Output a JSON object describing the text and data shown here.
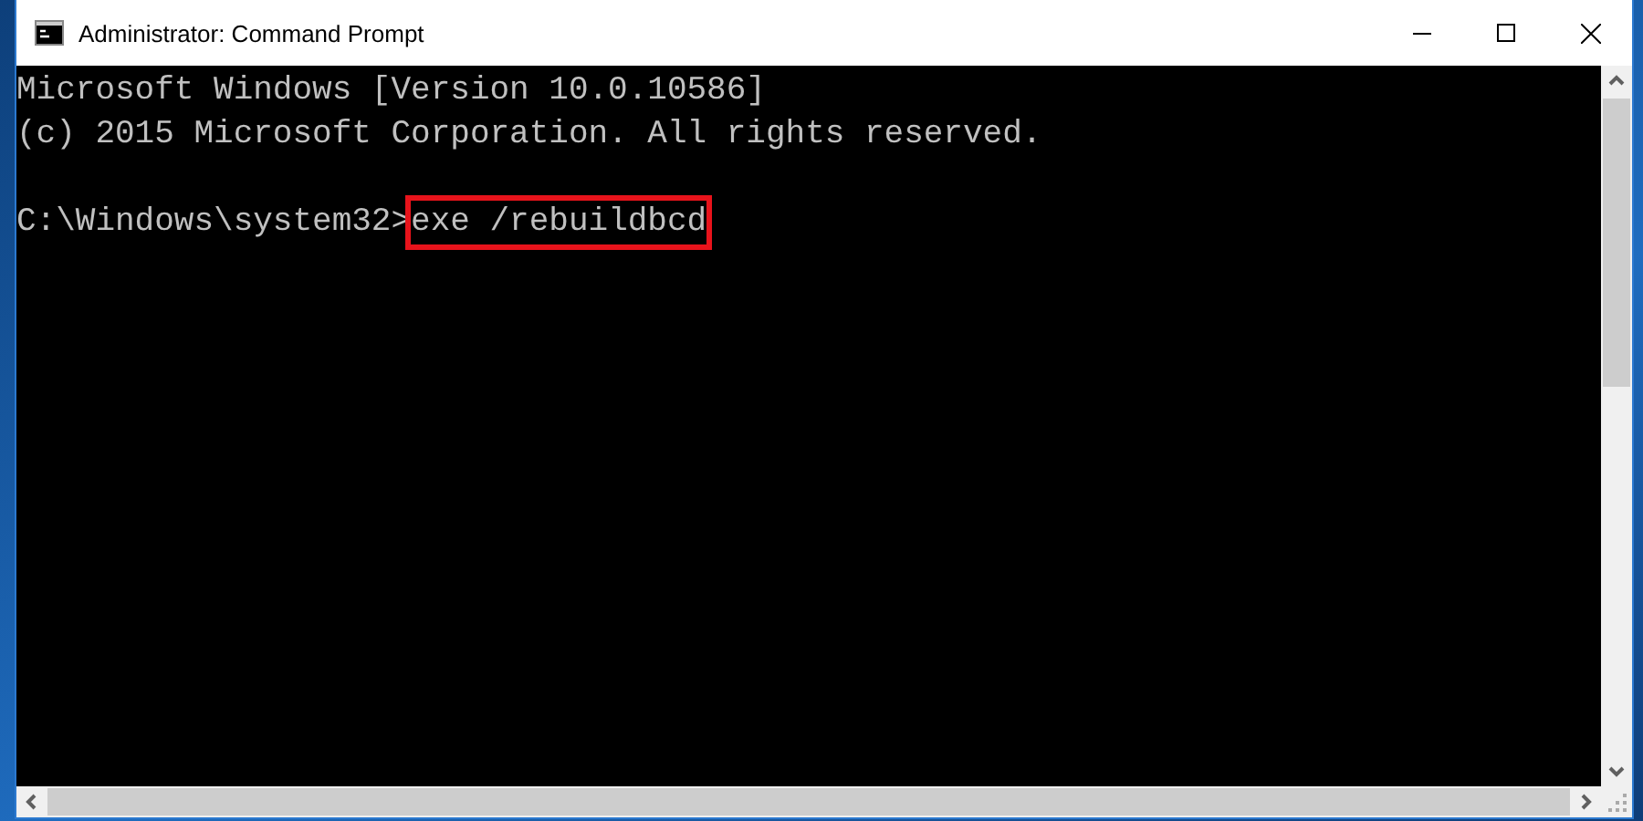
{
  "window": {
    "title": "Administrator: Command Prompt"
  },
  "console": {
    "lines": [
      {
        "kind": "output",
        "text": "Microsoft Windows [Version 10.0.10586]"
      },
      {
        "kind": "output",
        "text": "(c) 2015 Microsoft Corporation. All rights reserved."
      },
      {
        "kind": "blank"
      },
      {
        "kind": "command",
        "prompt": "C:\\Windows\\system32>",
        "command": "exe /rebuildbcd",
        "highlighted": true
      }
    ]
  }
}
